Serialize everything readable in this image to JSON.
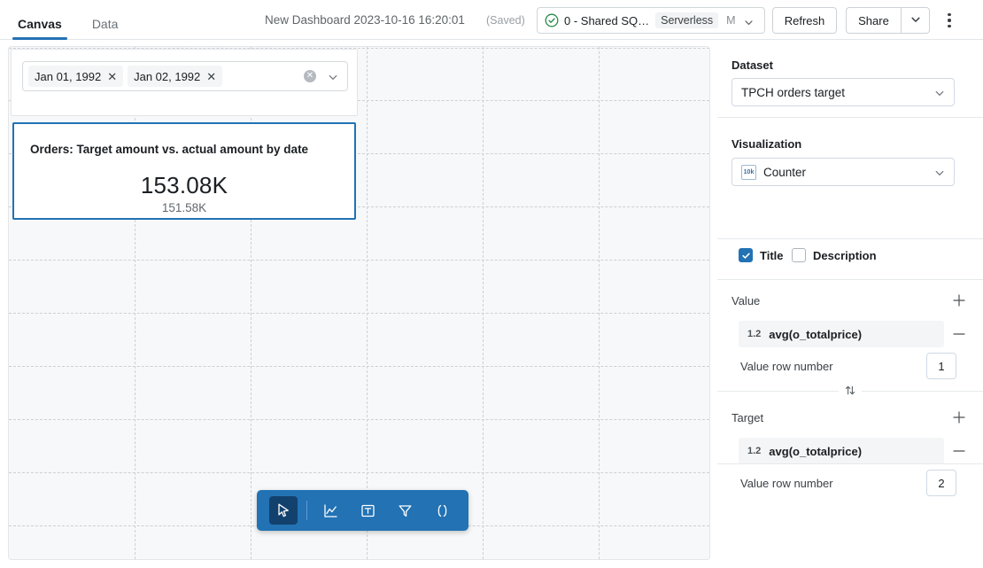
{
  "topbar": {
    "tabs": [
      {
        "label": "Canvas",
        "active": true
      },
      {
        "label": "Data",
        "active": false
      }
    ],
    "document_title": "New Dashboard 2023-10-16 16:20:01",
    "saved_status": "(Saved)",
    "cluster": {
      "status_icon": "check-circle-icon",
      "name": "0 - Shared SQ…",
      "type_chip": "Serverless",
      "size": "M",
      "caret_icon": "chevron-down-icon"
    },
    "refresh_label": "Refresh",
    "share_label": "Share",
    "share_caret_icon": "chevron-down-icon",
    "more_icon": "kebab-menu-icon"
  },
  "canvas": {
    "filter_widget": {
      "chips": [
        {
          "label": "Jan 01, 1992",
          "remove_icon": "close-icon"
        },
        {
          "label": "Jan 02, 1992",
          "remove_icon": "close-icon"
        }
      ],
      "clear_icon": "clear-all-icon",
      "caret_icon": "chevron-down-icon",
      "placeholder": ""
    },
    "counter_widget": {
      "title": "Orders: Target amount vs. actual amount by date",
      "value": "153.08K",
      "target": "151.58K"
    },
    "toolbar": {
      "tools": [
        {
          "name": "select-pointer-tool",
          "glyph": "pointer",
          "selected": true
        },
        {
          "name": "chart-tool",
          "glyph": "chart",
          "selected": false
        },
        {
          "name": "text-box-tool",
          "glyph": "textbox",
          "selected": false
        },
        {
          "name": "filter-tool",
          "glyph": "filter",
          "selected": false
        },
        {
          "name": "code-tool",
          "glyph": "code",
          "selected": false
        }
      ]
    }
  },
  "panel": {
    "dataset": {
      "label": "Dataset",
      "selected": "TPCH orders target",
      "caret_icon": "chevron-down-icon"
    },
    "visualization": {
      "label": "Visualization",
      "selected": "Counter",
      "icon_badge": "10k",
      "caret_icon": "chevron-down-icon",
      "title_checkbox": {
        "label": "Title",
        "checked": true
      },
      "description_checkbox": {
        "label": "Description",
        "checked": false
      }
    },
    "value_section": {
      "label": "Value",
      "add_icon": "plus-icon",
      "field": {
        "type_badge": "1.2",
        "name": "avg(o_totalprice)",
        "remove_icon": "minus-icon"
      },
      "row_number_label": "Value row number",
      "row_number_value": "1"
    },
    "swap_icon": "swap-vertical-icon",
    "target_section": {
      "label": "Target",
      "add_icon": "plus-icon",
      "field": {
        "type_badge": "1.2",
        "name": "avg(o_totalprice)",
        "remove_icon": "minus-icon"
      },
      "row_number_label": "Value row number",
      "row_number_value": "2"
    }
  },
  "colors": {
    "accent": "#2272b4",
    "accent_dark": "#12416d",
    "canvas_bg": "#f7f8f9",
    "border": "#e3e6e8",
    "success": "#2a8a4a"
  }
}
